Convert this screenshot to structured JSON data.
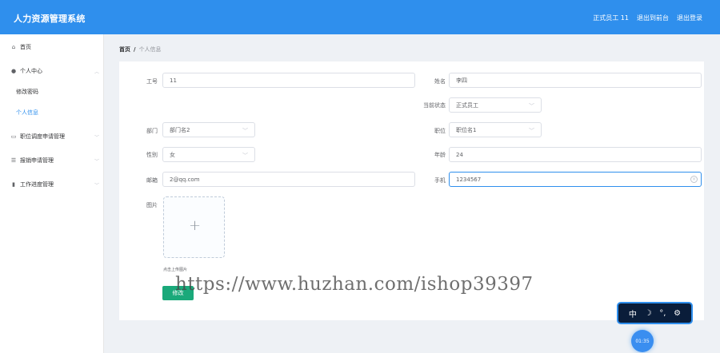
{
  "app_title": "人力资源管理系统",
  "header": {
    "user": "正式员工 11",
    "back_to_admin": "退出到前台",
    "logout": "退出登录"
  },
  "sidebar": {
    "home": "首页",
    "personal_center": "个人中心",
    "change_password": "修改密码",
    "personal_info": "个人信息",
    "transfer_apply": "职位调度申请管理",
    "expense_apply": "报销申请管理",
    "progress_mgmt": "工作进度管理"
  },
  "breadcrumb": {
    "home": "首页",
    "separator": "/",
    "current": "个人信息"
  },
  "form": {
    "employee_no": {
      "label": "工号",
      "value": "11"
    },
    "name": {
      "label": "姓名",
      "value": "李四"
    },
    "status": {
      "label": "当前状态",
      "value": "正式员工"
    },
    "department": {
      "label": "部门",
      "value": "部门名2"
    },
    "position": {
      "label": "职位",
      "value": "职位名1"
    },
    "gender": {
      "label": "性别",
      "value": "女"
    },
    "age": {
      "label": "年龄",
      "value": "24"
    },
    "email": {
      "label": "邮箱",
      "value": "2@qq.com"
    },
    "phone": {
      "label": "手机",
      "value": "1234567"
    },
    "image": {
      "label": "图片"
    },
    "upload_tip": "点击上传图片",
    "submit": "修改"
  },
  "watermark": "https://www.huzhan.com/ishop39397",
  "ime_toolbar": {
    "lang": "中",
    "moon": "☽",
    "punct": "°,",
    "settings": "⚙"
  },
  "clock": "01:35",
  "colors": {
    "header_bg": "#2f8fed",
    "active": "#2f8fed",
    "submit_bg": "#1aa97a"
  }
}
